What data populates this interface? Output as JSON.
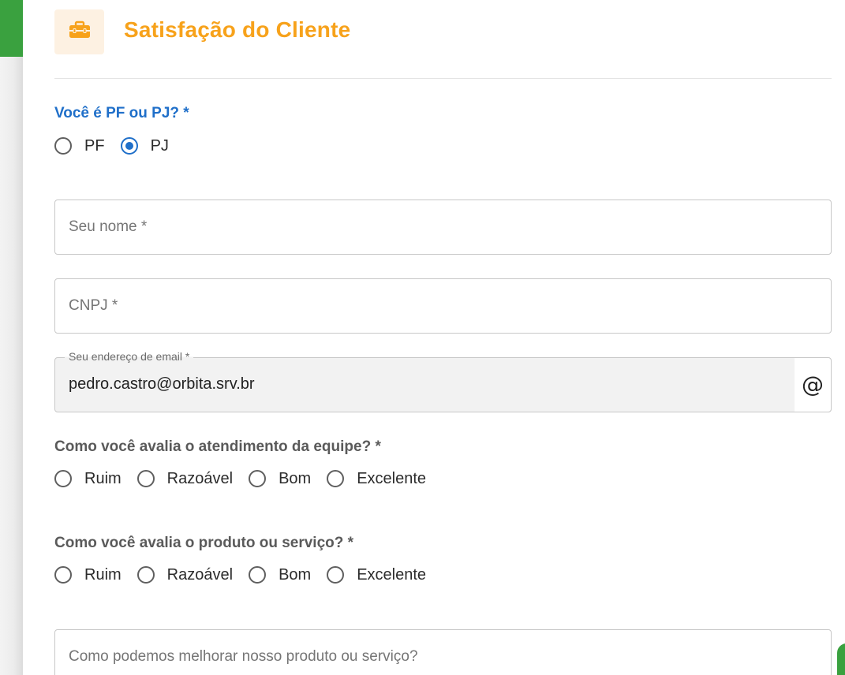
{
  "header": {
    "title": "Satisfação do Cliente",
    "icon": "briefcase-icon",
    "accent_color": "#f7a21b"
  },
  "person_type": {
    "label": "Você é PF ou PJ? *",
    "options": [
      "PF",
      "PJ"
    ],
    "selected": "PJ"
  },
  "fields": {
    "name_placeholder": "Seu nome *",
    "cnpj_placeholder": "CNPJ *",
    "email_label": "Seu endereço de email  *",
    "email_value": "pedro.castro@orbita.srv.br",
    "email_icon": "at-sign-icon",
    "email_icon_glyph": "@",
    "improve_placeholder": "Como podemos melhorar nosso produto ou serviço?"
  },
  "team_rating": {
    "label": "Como você avalia o atendimento da equipe? *",
    "options": [
      "Ruim",
      "Razoável",
      "Bom",
      "Excelente"
    ],
    "selected": null
  },
  "product_rating": {
    "label": "Como você avalia o produto ou serviço? *",
    "options": [
      "Ruim",
      "Razoável",
      "Bom",
      "Excelente"
    ],
    "selected": null
  },
  "colors": {
    "question_blue": "#1f6fc9",
    "sidebar_green": "#3aa13f"
  }
}
